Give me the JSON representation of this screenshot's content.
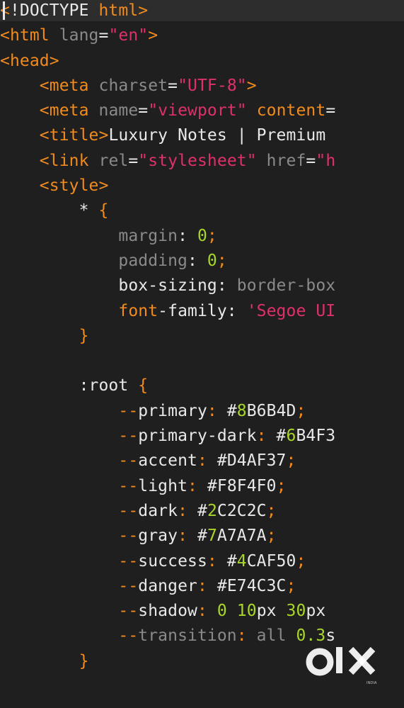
{
  "editor": {
    "lines": [
      {
        "segs": [
          [
            "tag",
            "<"
          ],
          [
            "txt",
            "!DOCTYPE "
          ],
          [
            "tag",
            "html"
          ],
          [
            "tag",
            ">"
          ]
        ]
      },
      {
        "segs": [
          [
            "tag",
            "<html"
          ],
          [
            "txt",
            " "
          ],
          [
            "attr",
            "lang"
          ],
          [
            "txt",
            "="
          ],
          [
            "str",
            "\"en\""
          ],
          [
            "tag",
            ">"
          ]
        ]
      },
      {
        "segs": [
          [
            "tag",
            "<head>"
          ]
        ]
      },
      {
        "segs": [
          [
            "txt",
            "    "
          ],
          [
            "tag",
            "<meta"
          ],
          [
            "txt",
            " "
          ],
          [
            "attr",
            "charset"
          ],
          [
            "txt",
            "="
          ],
          [
            "str",
            "\"UTF-8\""
          ],
          [
            "tag",
            ">"
          ]
        ]
      },
      {
        "segs": [
          [
            "txt",
            "    "
          ],
          [
            "tag",
            "<meta"
          ],
          [
            "txt",
            " "
          ],
          [
            "attr",
            "name"
          ],
          [
            "txt",
            "="
          ],
          [
            "str",
            "\"viewport\""
          ],
          [
            "txt",
            " "
          ],
          [
            "kw",
            "content"
          ],
          [
            "txt",
            "="
          ]
        ]
      },
      {
        "segs": [
          [
            "txt",
            "    "
          ],
          [
            "tag",
            "<title"
          ],
          [
            "tag",
            ">"
          ],
          [
            "txt",
            "Luxury Notes | Premium"
          ]
        ]
      },
      {
        "segs": [
          [
            "txt",
            "    "
          ],
          [
            "tag",
            "<link"
          ],
          [
            "txt",
            " "
          ],
          [
            "attr",
            "rel"
          ],
          [
            "txt",
            "="
          ],
          [
            "str",
            "\"stylesheet\""
          ],
          [
            "txt",
            " "
          ],
          [
            "attr",
            "href"
          ],
          [
            "txt",
            "="
          ],
          [
            "str",
            "\"h"
          ]
        ]
      },
      {
        "segs": [
          [
            "txt",
            "    "
          ],
          [
            "tag",
            "<style>"
          ]
        ]
      },
      {
        "segs": [
          [
            "txt",
            "        "
          ],
          [
            "prop",
            "* "
          ],
          [
            "tag",
            "{"
          ]
        ]
      },
      {
        "segs": [
          [
            "txt",
            "            "
          ],
          [
            "dim",
            "margin"
          ],
          [
            "txt",
            ": "
          ],
          [
            "num",
            "0"
          ],
          [
            "tag",
            ";"
          ]
        ]
      },
      {
        "segs": [
          [
            "txt",
            "            "
          ],
          [
            "dim",
            "padding"
          ],
          [
            "txt",
            ": "
          ],
          [
            "num",
            "0"
          ],
          [
            "tag",
            ";"
          ]
        ]
      },
      {
        "segs": [
          [
            "txt",
            "            "
          ],
          [
            "prop",
            "box-sizing"
          ],
          [
            "txt",
            ": "
          ],
          [
            "dim",
            "border-box"
          ]
        ]
      },
      {
        "segs": [
          [
            "txt",
            "            "
          ],
          [
            "kw",
            "font"
          ],
          [
            "txt",
            "-family: "
          ],
          [
            "str",
            "'Segoe UI"
          ]
        ]
      },
      {
        "segs": [
          [
            "txt",
            "        "
          ],
          [
            "tag",
            "}"
          ]
        ]
      },
      {
        "segs": [
          [
            "txt",
            ""
          ]
        ]
      },
      {
        "segs": [
          [
            "txt",
            "        "
          ],
          [
            "prop",
            ":root "
          ],
          [
            "tag",
            "{"
          ]
        ]
      },
      {
        "segs": [
          [
            "txt",
            "            "
          ],
          [
            "kw",
            "--"
          ],
          [
            "txt",
            "primary"
          ],
          [
            "kw",
            ":"
          ],
          [
            "txt",
            " #"
          ],
          [
            "num",
            "8"
          ],
          [
            "txt",
            "B6B4D"
          ],
          [
            "tag",
            ";"
          ]
        ]
      },
      {
        "segs": [
          [
            "txt",
            "            "
          ],
          [
            "kw",
            "--"
          ],
          [
            "txt",
            "primary-dark"
          ],
          [
            "kw",
            ":"
          ],
          [
            "txt",
            " #"
          ],
          [
            "num",
            "6"
          ],
          [
            "txt",
            "B4F3"
          ]
        ]
      },
      {
        "segs": [
          [
            "txt",
            "            "
          ],
          [
            "kw",
            "--"
          ],
          [
            "txt",
            "accent"
          ],
          [
            "kw",
            ":"
          ],
          [
            "txt",
            " #D4AF37"
          ],
          [
            "tag",
            ";"
          ]
        ]
      },
      {
        "segs": [
          [
            "txt",
            "            "
          ],
          [
            "kw",
            "--"
          ],
          [
            "txt",
            "light"
          ],
          [
            "kw",
            ":"
          ],
          [
            "txt",
            " #F8F4F0"
          ],
          [
            "tag",
            ";"
          ]
        ]
      },
      {
        "segs": [
          [
            "txt",
            "            "
          ],
          [
            "kw",
            "--"
          ],
          [
            "txt",
            "dark"
          ],
          [
            "kw",
            ":"
          ],
          [
            "txt",
            " #"
          ],
          [
            "num",
            "2"
          ],
          [
            "txt",
            "C2C2C"
          ],
          [
            "tag",
            ";"
          ]
        ]
      },
      {
        "segs": [
          [
            "txt",
            "            "
          ],
          [
            "kw",
            "--"
          ],
          [
            "txt",
            "gray"
          ],
          [
            "kw",
            ":"
          ],
          [
            "txt",
            " #"
          ],
          [
            "num",
            "7"
          ],
          [
            "txt",
            "A7A7A"
          ],
          [
            "tag",
            ";"
          ]
        ]
      },
      {
        "segs": [
          [
            "txt",
            "            "
          ],
          [
            "kw",
            "--"
          ],
          [
            "txt",
            "success"
          ],
          [
            "kw",
            ":"
          ],
          [
            "txt",
            " #"
          ],
          [
            "num",
            "4"
          ],
          [
            "txt",
            "CAF50"
          ],
          [
            "tag",
            ";"
          ]
        ]
      },
      {
        "segs": [
          [
            "txt",
            "            "
          ],
          [
            "kw",
            "--"
          ],
          [
            "txt",
            "danger"
          ],
          [
            "kw",
            ":"
          ],
          [
            "txt",
            " #E74C3C"
          ],
          [
            "tag",
            ";"
          ]
        ]
      },
      {
        "segs": [
          [
            "txt",
            "            "
          ],
          [
            "kw",
            "--"
          ],
          [
            "txt",
            "shadow"
          ],
          [
            "kw",
            ":"
          ],
          [
            "txt",
            " "
          ],
          [
            "num",
            "0"
          ],
          [
            "txt",
            " "
          ],
          [
            "num",
            "10"
          ],
          [
            "txt",
            "px "
          ],
          [
            "num",
            "30"
          ],
          [
            "txt",
            "px"
          ]
        ]
      },
      {
        "segs": [
          [
            "txt",
            "            "
          ],
          [
            "kw",
            "--"
          ],
          [
            "dim",
            "transition"
          ],
          [
            "kw",
            ":"
          ],
          [
            "txt",
            " "
          ],
          [
            "dim",
            "all "
          ],
          [
            "num",
            "0.3"
          ],
          [
            "txt",
            "s"
          ]
        ]
      },
      {
        "segs": [
          [
            "txt",
            "        "
          ],
          [
            "tag",
            "}"
          ]
        ]
      }
    ]
  },
  "watermark": {
    "brand": "OLX",
    "sub": "INDIA",
    "color": "#ffffff"
  },
  "colors": {
    "background": "#1f1f1f",
    "tag": "#f28b1e",
    "string": "#e0306a",
    "number": "#a9d62b",
    "dim": "#8a8a8a",
    "text": "#e8e8e8"
  }
}
